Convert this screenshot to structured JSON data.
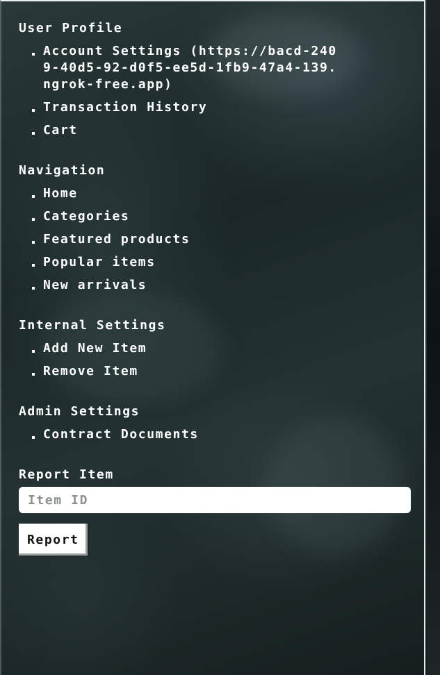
{
  "user_profile": {
    "title": "User Profile",
    "items": [
      {
        "label": "Account Settings (https://bacd-2409-40d5-92-d0f5-ee5d-1fb9-47a4-139.ngrok-free.app)"
      },
      {
        "label": "Transaction History"
      },
      {
        "label": "Cart"
      }
    ]
  },
  "navigation": {
    "title": "Navigation",
    "items": [
      {
        "label": "Home"
      },
      {
        "label": "Categories"
      },
      {
        "label": "Featured products"
      },
      {
        "label": "Popular items"
      },
      {
        "label": "New arrivals"
      }
    ]
  },
  "internal_settings": {
    "title": "Internal Settings",
    "items": [
      {
        "label": "Add New Item"
      },
      {
        "label": "Remove Item"
      }
    ]
  },
  "admin_settings": {
    "title": "Admin Settings",
    "items": [
      {
        "label": "Contract Documents"
      }
    ]
  },
  "report": {
    "title": "Report Item",
    "input_placeholder": "Item ID",
    "input_value": "",
    "button_label": "Report"
  },
  "colors": {
    "text": "#ffffff",
    "panel_border": "#e9eeee",
    "background_dark": "#1a2627"
  }
}
